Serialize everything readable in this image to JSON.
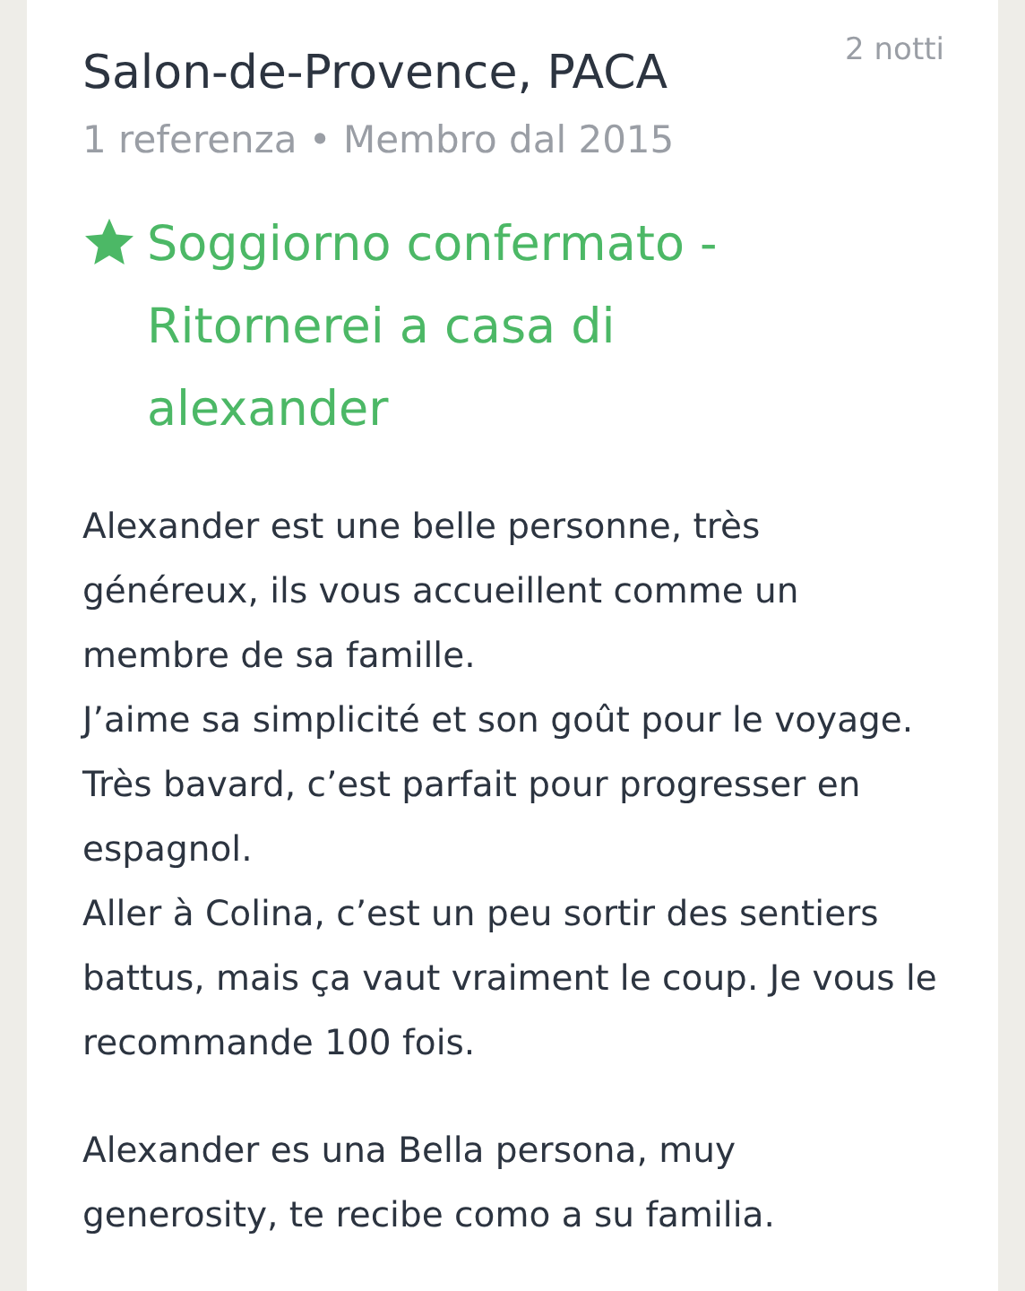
{
  "review": {
    "nights": "2 notti",
    "location": "Salon-de-Provence, PACA",
    "meta": "1 referenza • Membro dal 2015",
    "headline": "Soggiorno confermato - Ritornerei a casa di alexander",
    "paragraphs": [
      [
        "Alexander est une belle personne, très généreux, ils vous accueillent comme un membre de sa famille.",
        "J’aime sa simplicité et son goût pour le voyage.",
        "Très bavard, c’est parfait pour progresser en espagnol.",
        "Aller à Colina, c’est un peu sortir des sentiers battus, mais ça vaut vraiment le coup. Je vous le recommande 100 fois."
      ],
      [
        "Alexander es una Bella persona, muy generosity, te recibe como a su familia."
      ]
    ]
  }
}
